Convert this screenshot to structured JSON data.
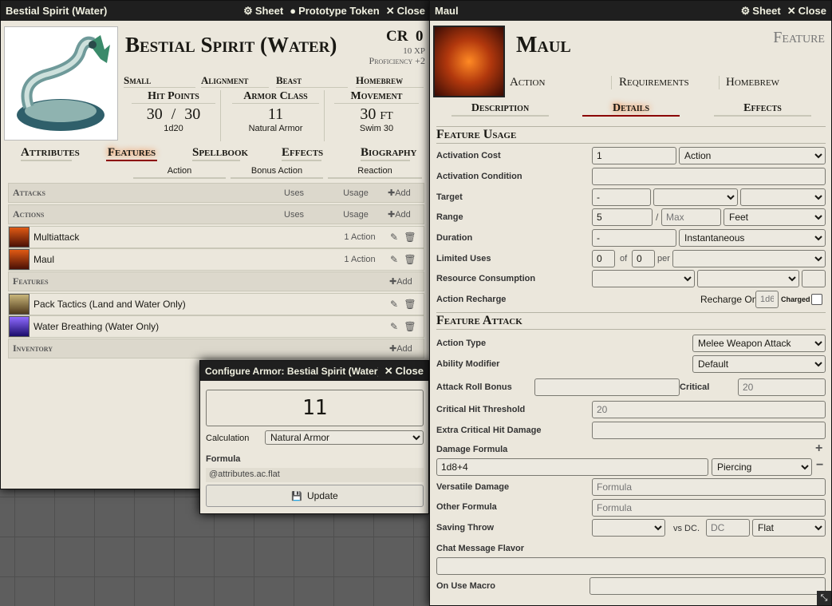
{
  "actor": {
    "title": "Bestial Spirit (Water)",
    "header_sheet": "Sheet",
    "header_token": "Prototype Token",
    "header_close": "Close",
    "name": "Bestial Spirit (Water)",
    "cr_label": "CR",
    "cr_value": "0",
    "xp": "10 XP",
    "proficiency": "Proficiency +2",
    "size": "Small",
    "alignment": "Alignment",
    "type": "Beast",
    "source": "Homebrew",
    "hp_label": "Hit Points",
    "hp_value": "30",
    "hp_max": "30",
    "hp_sep": "/",
    "hit_dice": "1d20",
    "ac_label": "Armor Class",
    "ac_value": "11",
    "ac_note": "Natural Armor",
    "move_label": "Movement",
    "move_value": "30",
    "move_unit": "ft",
    "move_note": "Swim 30",
    "tabs": [
      "Attributes",
      "Features",
      "Spellbook",
      "Effects",
      "Biography"
    ],
    "sub_tabs": [
      "Action",
      "Bonus Action",
      "Reaction"
    ],
    "sections": {
      "attacks": "Attacks",
      "actions": "Actions",
      "features": "Features",
      "inventory": "Inventory",
      "uses": "Uses",
      "usage": "Usage",
      "add": "Add"
    },
    "action_items": [
      {
        "name": "Multiattack",
        "usage": "1 Action"
      },
      {
        "name": "Maul",
        "usage": "1 Action"
      }
    ],
    "feature_items": [
      {
        "name": "Pack Tactics (Land and Water Only)"
      },
      {
        "name": "Water Breathing (Water Only)"
      }
    ]
  },
  "armor": {
    "title": "Configure Armor: Bestial Spirit (Water)",
    "close": "Close",
    "value": "11",
    "calc_label": "Calculation",
    "calc_value": "Natural Armor",
    "formula_label": "Formula",
    "formula_value": "@attributes.ac.flat",
    "update": "Update"
  },
  "item": {
    "title": "Maul",
    "header_sheet": "Sheet",
    "header_close": "Close",
    "name": "Maul",
    "type": "Feature",
    "sub": [
      "Action",
      "Requirements",
      "Homebrew"
    ],
    "tabs": [
      "Description",
      "Details",
      "Effects"
    ],
    "usage_heading": "Feature Usage",
    "activation_cost": "Activation Cost",
    "activation_cost_value": "1",
    "activation_type": "Action",
    "activation_condition": "Activation Condition",
    "target": "Target",
    "target_value": "-",
    "range": "Range",
    "range_value": "5",
    "range_sep": "/",
    "range_max_ph": "Max",
    "range_unit": "Feet",
    "duration": "Duration",
    "duration_value": "-",
    "duration_unit": "Instantaneous",
    "limited_uses": "Limited Uses",
    "uses_value": "0",
    "uses_of": "of",
    "uses_max": "0",
    "uses_per": "per",
    "resource": "Resource Consumption",
    "recharge": "Action Recharge",
    "recharge_on": "Recharge On",
    "recharge_ph": "1d6",
    "charged": "Charged",
    "attack_heading": "Feature Attack",
    "action_type": "Action Type",
    "action_type_value": "Melee Weapon Attack",
    "ability_mod": "Ability Modifier",
    "ability_mod_value": "Default",
    "attack_bonus": "Attack Roll Bonus",
    "critical": "Critical",
    "critical_ph": "20",
    "crit_threshold": "Critical Hit Threshold",
    "crit_threshold_ph": "20",
    "extra_crit": "Extra Critical Hit Damage",
    "damage_formula": "Damage Formula",
    "damage_value": "1d8+4",
    "damage_type": "Piercing",
    "versatile": "Versatile Damage",
    "versatile_ph": "Formula",
    "other_formula": "Other Formula",
    "other_ph": "Formula",
    "saving_throw": "Saving Throw",
    "vs_dc": "vs DC.",
    "dc_ph": "DC",
    "dc_mode": "Flat",
    "chat_flavor": "Chat Message Flavor",
    "use_macro": "On Use Macro"
  },
  "colors": {
    "accent": "#8b0000",
    "header": "#1f1f1f",
    "parchment": "#ebe7dc"
  }
}
